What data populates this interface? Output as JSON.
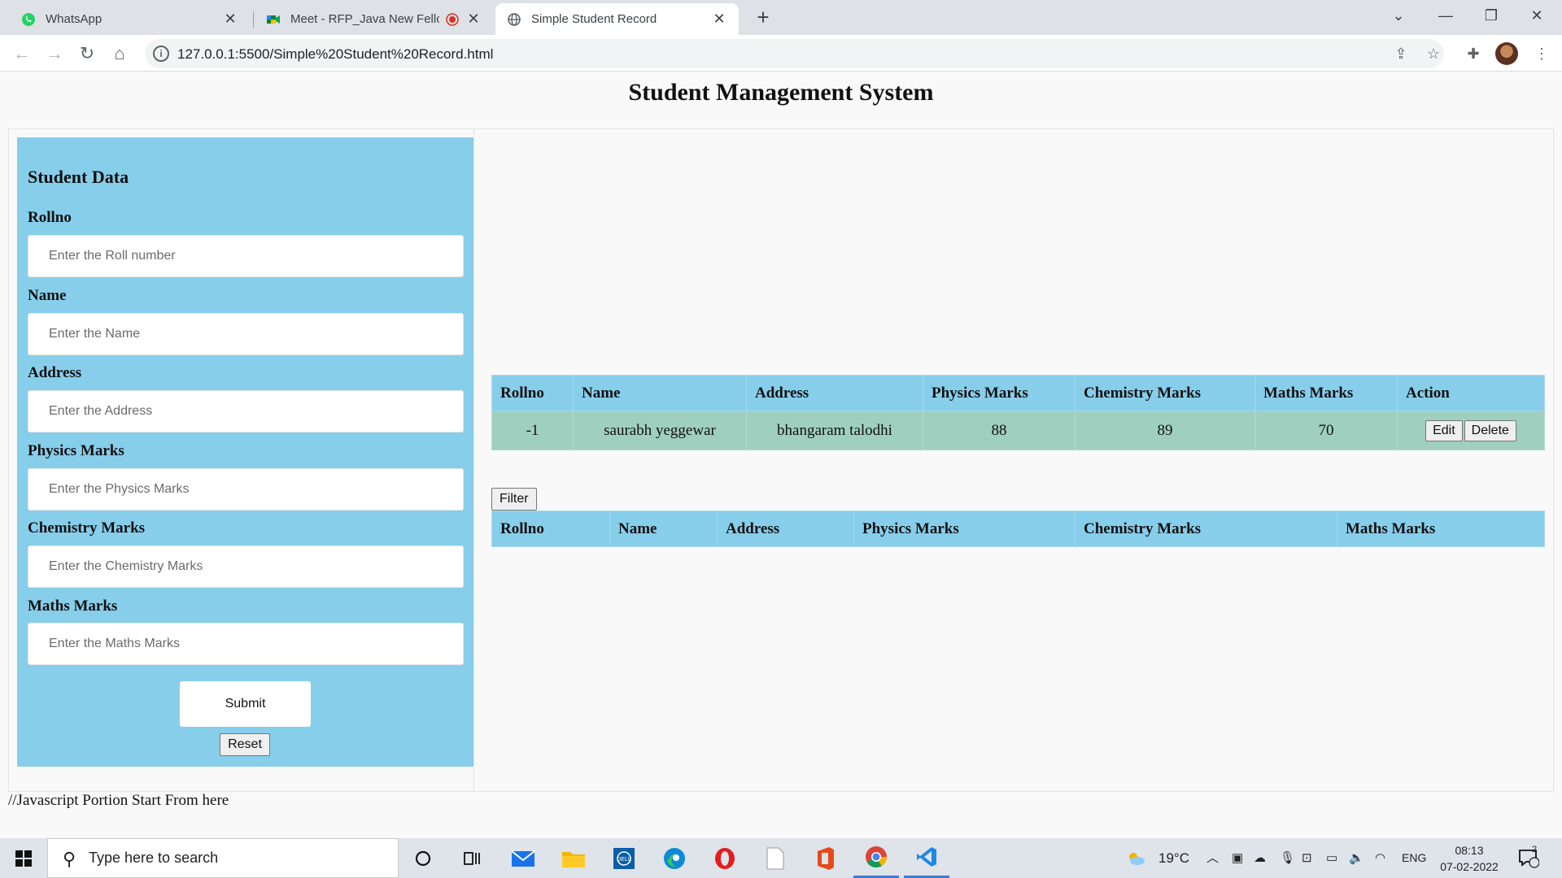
{
  "browser": {
    "tabs": [
      {
        "title": "WhatsApp",
        "active": false,
        "icon": "whatsapp-icon"
      },
      {
        "title": "Meet - RFP_Java New Fellow",
        "active": false,
        "icon": "google-meet-icon"
      },
      {
        "title": "Simple Student Record",
        "active": true,
        "icon": "globe-icon"
      }
    ],
    "url": "127.0.0.1:5500/Simple%20Student%20Record.html"
  },
  "page": {
    "title": "Student Management System",
    "form": {
      "heading": "Student Data",
      "fields": [
        {
          "label": "Rollno",
          "placeholder": "Enter the Roll number",
          "value": ""
        },
        {
          "label": "Name",
          "placeholder": "Enter the Name",
          "value": ""
        },
        {
          "label": "Address",
          "placeholder": "Enter the Address",
          "value": ""
        },
        {
          "label": "Physics Marks",
          "placeholder": "Enter the Physics Marks",
          "value": ""
        },
        {
          "label": "Chemistry Marks",
          "placeholder": "Enter the Chemistry Marks",
          "value": ""
        },
        {
          "label": "Maths Marks",
          "placeholder": "Enter the Maths Marks",
          "value": ""
        }
      ],
      "submit_label": "Submit",
      "reset_label": "Reset"
    },
    "records_table": {
      "headers": [
        "Rollno",
        "Name",
        "Address",
        "Physics Marks",
        "Chemistry Marks",
        "Maths Marks",
        "Action"
      ],
      "rows": [
        {
          "rollno": "-1",
          "name": "saurabh yeggewar",
          "address": "bhangaram talodhi",
          "physics": "88",
          "chemistry": "89",
          "maths": "70"
        }
      ],
      "edit_label": "Edit",
      "delete_label": "Delete"
    },
    "filter_label": "Filter",
    "filter_table": {
      "headers": [
        "Rollno",
        "Name",
        "Address",
        "Physics Marks",
        "Chemistry Marks",
        "Maths Marks"
      ]
    },
    "footer_text": "//Javascript Portion Start From here"
  },
  "taskbar": {
    "search_placeholder": "Type here to search",
    "weather": "19°C",
    "language": "ENG",
    "time": "08:13",
    "date": "07-02-2022",
    "notifications": "2"
  },
  "colors": {
    "panel": "#87ceeb",
    "row": "#9fcfbf"
  }
}
